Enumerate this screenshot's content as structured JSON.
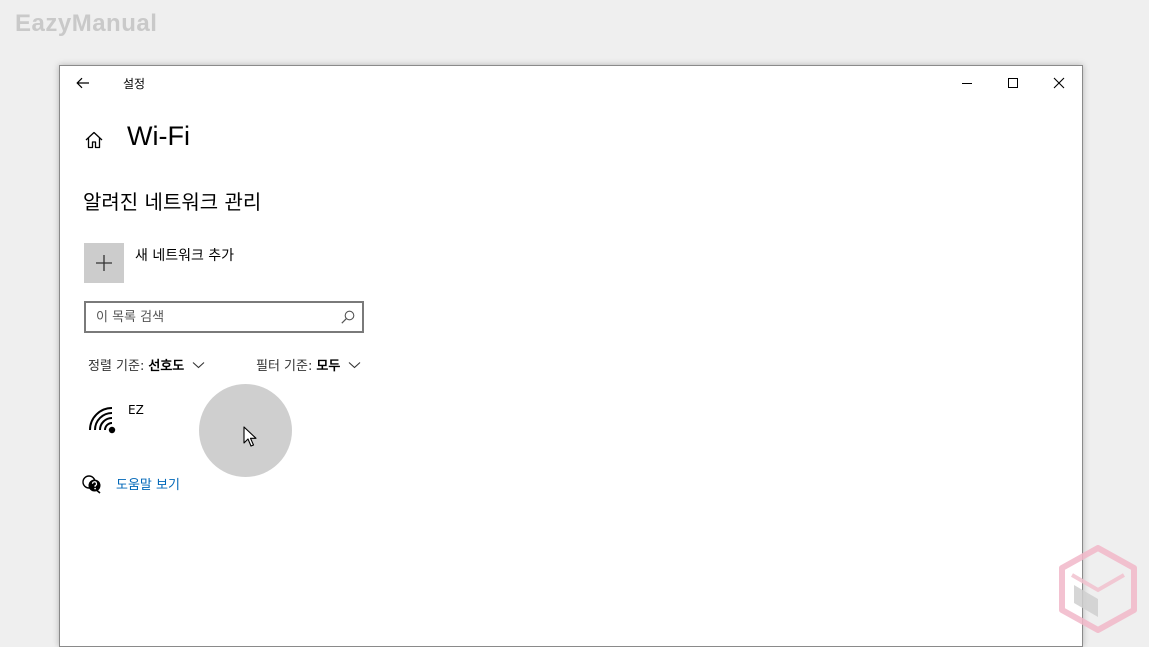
{
  "brand": {
    "text": "EazyManual"
  },
  "window": {
    "title": "설정",
    "controls": {
      "minimize": "minimize-icon",
      "maximize": "maximize-icon",
      "close": "close-icon"
    }
  },
  "page": {
    "title": "Wi-Fi",
    "section_title": "알려진 네트워크 관리"
  },
  "add_network": {
    "label": "새 네트워크 추가",
    "icon": "plus-icon"
  },
  "search": {
    "placeholder": "이 목록 검색",
    "value": ""
  },
  "sort": {
    "label": "정렬 기준:",
    "value": "선호도"
  },
  "filter": {
    "label": "필터 기준:",
    "value": "모두"
  },
  "networks": [
    {
      "name": "EZ",
      "icon": "wifi-icon"
    }
  ],
  "help": {
    "label": "도움말 보기",
    "icon": "help-chat-icon"
  },
  "colors": {
    "link": "#0067b8",
    "tile": "#cccccc",
    "background": "#efefef",
    "window": "#ffffff",
    "brand": "#c9c9c9"
  }
}
